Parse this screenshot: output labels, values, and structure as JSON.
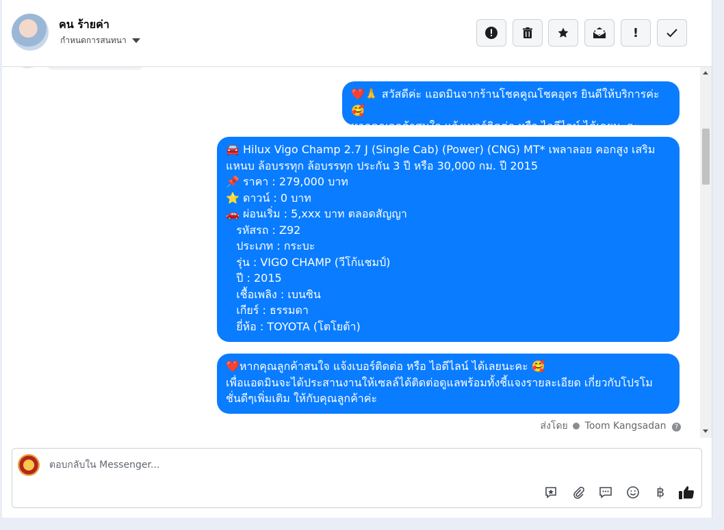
{
  "header": {
    "contact_name": "คน ร้ายค่า",
    "subtitle": "กำหนดการสนทนา",
    "toolbar": [
      {
        "name": "spam-button",
        "glyph": "●!"
      },
      {
        "name": "delete-button",
        "glyph": "🗑"
      },
      {
        "name": "star-button",
        "glyph": "★"
      },
      {
        "name": "mark-unread-button",
        "glyph": "✉"
      },
      {
        "name": "important-button",
        "glyph": "!"
      },
      {
        "name": "done-button",
        "glyph": "✓"
      }
    ]
  },
  "messages": [
    {
      "lines": [
        "❤️🙏 สวัสดีค่ะ แอดมินจากร้านโชคคูณโชคอุดร ยินดีให้บริการค่ะ🥰",
        "หากคุณลูกค้าสนใจ แจ้งเบอร์ติดต่อ หรือ ไอดีไลน์ ได้เลยนะคะ"
      ]
    },
    {
      "lines": [
        "🚘 Hilux Vigo Champ 2.7 J (Single Cab) (Power) (CNG) MT* เพลาลอย คอกสูง เสริม",
        "แหนบ ล้อบรรทุก ล้อบรรทุก ประกัน 3 ปี หรือ 30,000 กม. ปี 2015",
        "📌 ราคา : 279,000 บาท",
        "⭐ ดาวน์ : 0 บาท",
        "🚗 ผ่อนเริ่ม : 5,xxx บาท ตลอดสัญญา",
        "   รหัสรถ : Z92",
        "   ประเภท : กระบะ",
        "   รุ่น : VIGO CHAMP (วีโก้แชมป์)",
        "   ปี : 2015",
        "   เชื้อเพลิง : เบนซิน",
        "   เกียร์ : ธรรมดา",
        "   ยี่ห้อ : TOYOTA (โตโยต้า)"
      ]
    },
    {
      "lines": [
        "❤️หากคุณลูกค้าสนใจ แจ้งเบอร์ติดต่อ หรือ ไอดีไลน์ ได้เลยนะคะ 🥰",
        "เพื่อแอดมินจะได้ประสานงานให้เซลล์ได้ติดต่อดูแลพร้อมทั้งชี้แจงรายละเอียด เกี่ยวกับโปรโม",
        "ชั่นดีๆเพิ่มเติม ให้กับคุณลูกค้าค่ะ"
      ]
    }
  ],
  "sent_by": {
    "prefix": "ส่งโดย",
    "agent": "Toom Kangsadan",
    "help": "?"
  },
  "composer": {
    "placeholder": "ตอบกลับใน Messenger...",
    "icons": [
      {
        "name": "saved-reply-icon",
        "glyph": "✪"
      },
      {
        "name": "attach-icon",
        "glyph": "📎"
      },
      {
        "name": "chat-bubble-icon",
        "glyph": "💬"
      },
      {
        "name": "emoji-icon",
        "glyph": "☺"
      },
      {
        "name": "baht-icon",
        "glyph": "฿"
      },
      {
        "name": "like-icon",
        "glyph": "👍"
      }
    ]
  }
}
